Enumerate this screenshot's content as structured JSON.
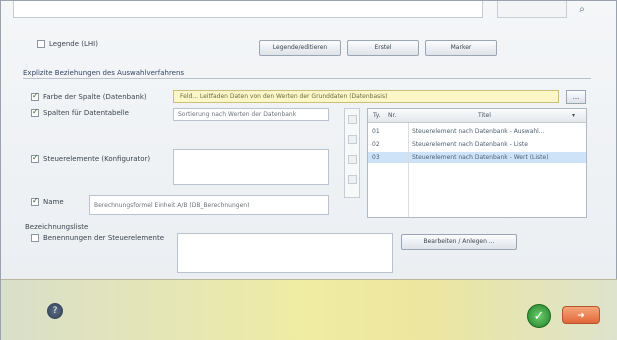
{
  "top": {
    "combo_value": "",
    "icon": "search-icon"
  },
  "legend": {
    "label": "Legende (LHI)",
    "checked": false
  },
  "buttons": {
    "btn1": "Legende/editieren",
    "btn2": "Erstel",
    "btn3": "Marker"
  },
  "group": {
    "title": "Explizite Beziehungen des Auswahlverfahrens"
  },
  "rows": {
    "row1_label": "Farbe der Spalte (Datenbank)",
    "row1_value": "Feld... Leitfaden Daten von den Werten der Grunddaten (Datenbasis)",
    "row2_label": "Spalten für Datentabelle",
    "row2_value": "Sortierung nach Werten der Datenbank",
    "row3_label": "Steuerelemente (Konfigurator)",
    "row4_label": "Name",
    "row4_value": "Berechnungsformel Einheit A/B (DB_Berechnungen)",
    "row5_group": "Bezeichnungsliste",
    "row5_label": "Benennungen der Steuerelemente",
    "right_button": "Bearbeiten / Anlegen ...",
    "side_button": "..."
  },
  "table": {
    "headers": [
      "Ty.",
      "Nr.",
      "Titel"
    ],
    "rows": [
      {
        "col1": "01",
        "col2": "Steuerelement nach Datenbank - Auswahl...",
        "selected": false
      },
      {
        "col1": "02",
        "col2": "Steuerelement nach Datenbank - Liste",
        "selected": false
      },
      {
        "col1": "03",
        "col2": "Steuerelement nach Datenbank - Wert (Liste)",
        "selected": true
      }
    ]
  },
  "footer": {
    "help_icon": "help-icon",
    "ok_icon": "checkmark-icon",
    "cancel_icon": "arrow-right-icon"
  }
}
